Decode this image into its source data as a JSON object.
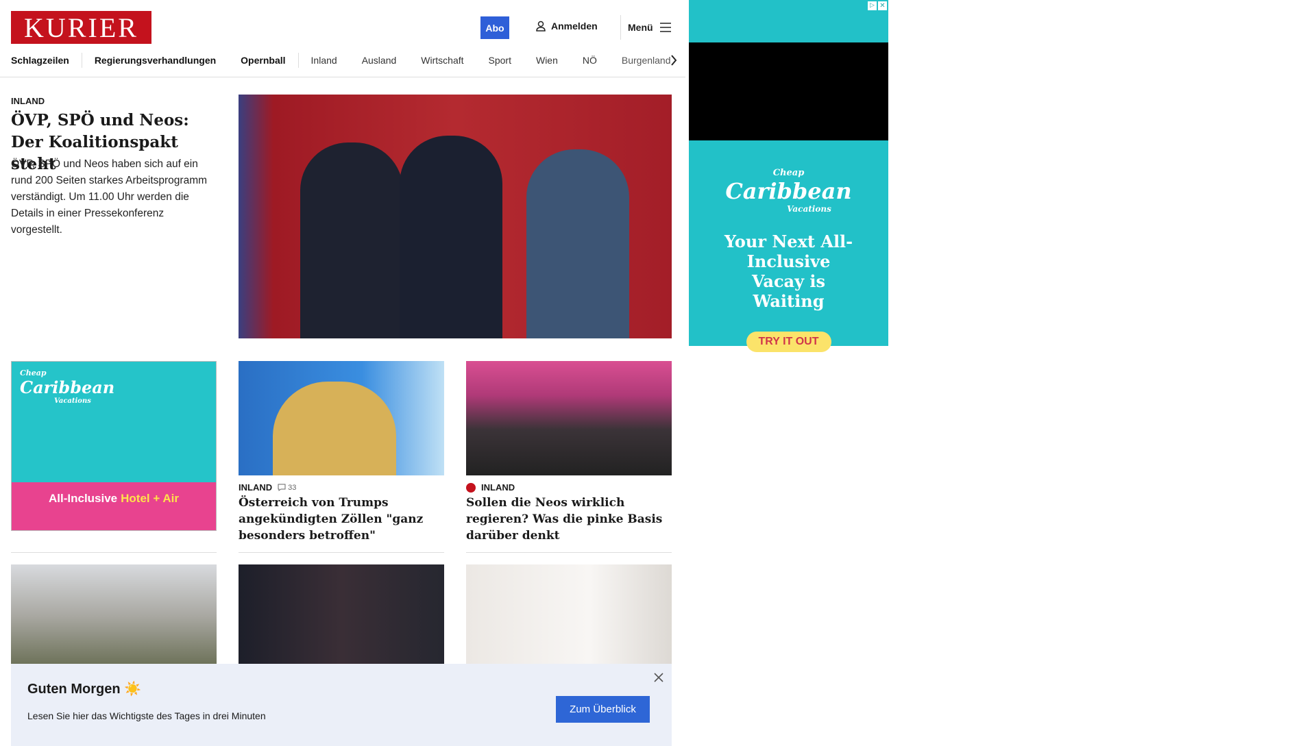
{
  "header": {
    "logo": "KURIER",
    "abo": "Abo",
    "login": "Anmelden",
    "menu": "Menü"
  },
  "nav": [
    "Schlagzeilen",
    "Regierungsverhandlungen",
    "Opernball",
    "Inland",
    "Ausland",
    "Wirtschaft",
    "Sport",
    "Wien",
    "NÖ",
    "Burgenland"
  ],
  "hero": {
    "kicker": "INLAND",
    "headline": "ÖVP, SPÖ und Neos: Der Koalitionspakt steht",
    "teaser": "ÖVP, SPÖ und Neos haben sich auf ein rund 200 Seiten starkes Arbeitsprogramm verständigt. Um 11.00 Uhr werden die Details in einer Pressekonferenz vorgestellt."
  },
  "articles": [
    {
      "kicker": "INLAND",
      "comments": "33",
      "headline": "Österreich von Trumps angekündigten Zöllen \"ganz besonders betroffen\""
    },
    {
      "kicker": "INLAND",
      "headline": "Sollen die Neos wirklich regieren? Was die pinke Basis darüber denkt"
    }
  ],
  "ad_small": {
    "brand_top": "Cheap",
    "brand": "Caribbean",
    "brand_sub": "Vacations",
    "line1": "All-Inclusive",
    "line2": "Hotel + Air"
  },
  "ad_side": {
    "brand_top": "Cheap",
    "brand": "Caribbean",
    "brand_sub": "Vacations",
    "headline": "Your Next All-Inclusive Vacay is Waiting",
    "cta": "TRY IT OUT"
  },
  "banner": {
    "title": "Guten Morgen ☀️",
    "text": "Lesen Sie hier das Wichtigste des Tages in drei Minuten",
    "button": "Zum Überblick"
  },
  "colors": {
    "brand": "#c4121d",
    "accent": "#2e5fd8",
    "ad_teal": "#22c1c8",
    "ad_pink": "#e8438f"
  }
}
